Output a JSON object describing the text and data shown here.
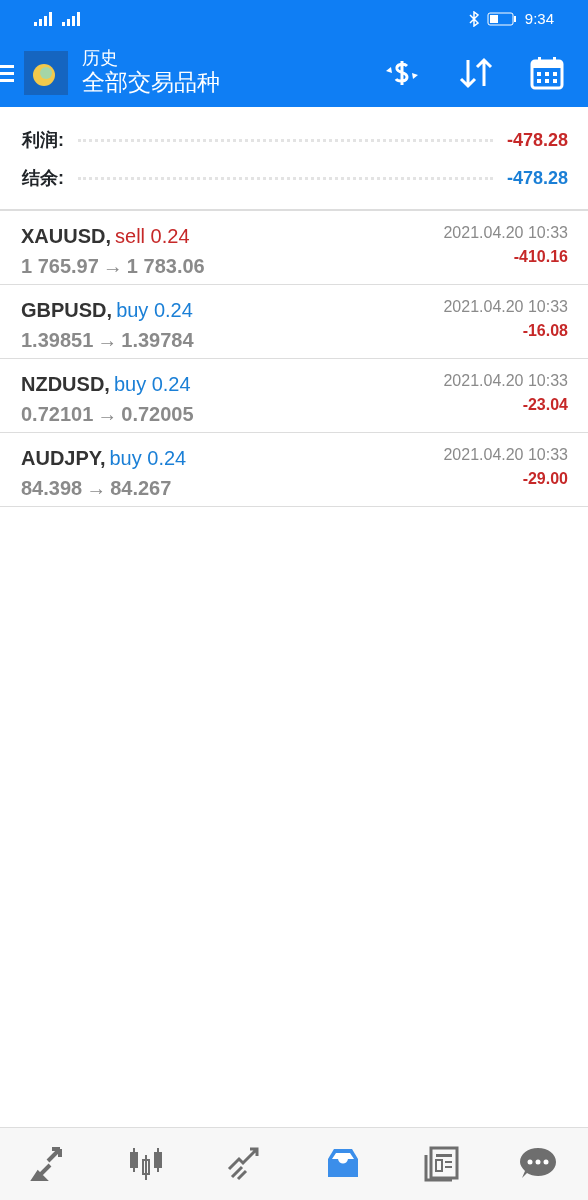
{
  "status_bar": {
    "time": "9:34"
  },
  "header": {
    "title": "历史",
    "subtitle": "全部交易品种"
  },
  "summary": [
    {
      "label": "利润:",
      "value": "-478.28",
      "kind": "profit"
    },
    {
      "label": "结余:",
      "value": "-478.28",
      "kind": "balance"
    }
  ],
  "trades": [
    {
      "symbol": "XAUUSD,",
      "side": "sell",
      "volume": "0.24",
      "open_price": "1 765.97",
      "arrow": "→",
      "close_price": "1 783.06",
      "time": "2021.04.20 10:33",
      "profit": "-410.16"
    },
    {
      "symbol": "GBPUSD,",
      "side": "buy",
      "volume": "0.24",
      "open_price": "1.39851",
      "arrow": "→",
      "close_price": "1.39784",
      "time": "2021.04.20 10:33",
      "profit": "-16.08"
    },
    {
      "symbol": "NZDUSD,",
      "side": "buy",
      "volume": "0.24",
      "open_price": "0.72101",
      "arrow": "→",
      "close_price": "0.72005",
      "time": "2021.04.20 10:33",
      "profit": "-23.04"
    },
    {
      "symbol": "AUDJPY,",
      "side": "buy",
      "volume": "0.24",
      "open_price": "84.398",
      "arrow": "→",
      "close_price": "84.267",
      "time": "2021.04.20 10:33",
      "profit": "-29.00"
    }
  ],
  "bottom_nav": [
    {
      "kind": "quotes",
      "selected": false
    },
    {
      "kind": "charts",
      "selected": false
    },
    {
      "kind": "trade",
      "selected": false
    },
    {
      "kind": "history",
      "selected": true
    },
    {
      "kind": "news",
      "selected": false
    },
    {
      "kind": "chat",
      "selected": false
    }
  ]
}
